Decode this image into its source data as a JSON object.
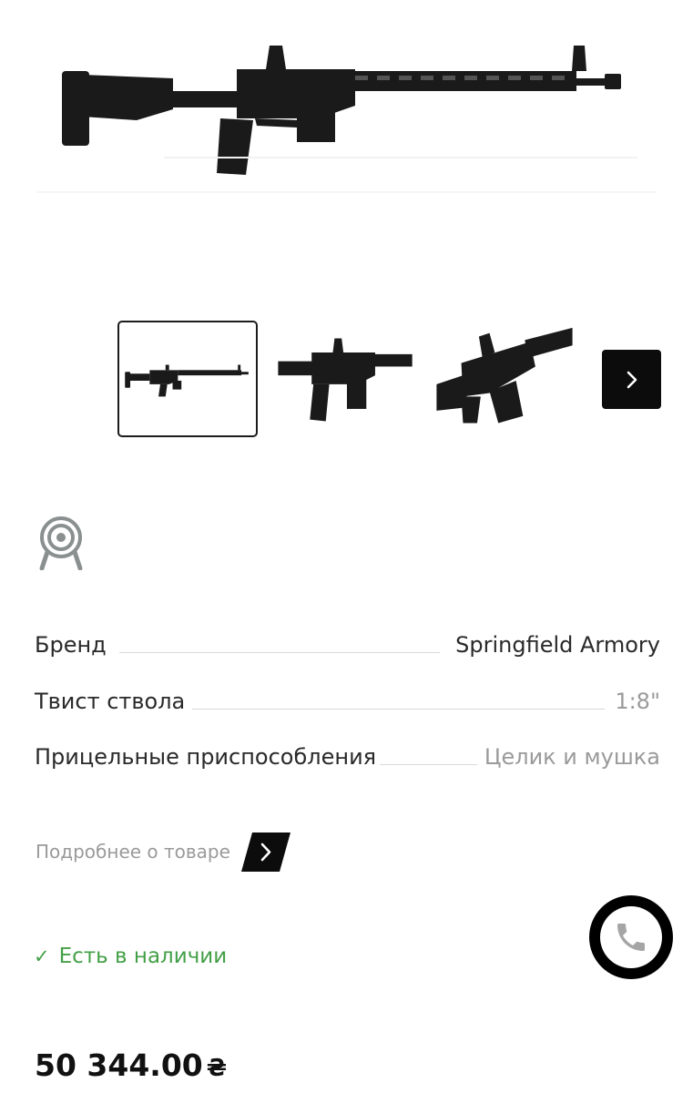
{
  "product": {
    "image_alt": "Springfield Armory rifle"
  },
  "gallery": {
    "thumbnails": [
      {
        "name": "full-rifle"
      },
      {
        "name": "receiver-side"
      },
      {
        "name": "receiver-angle"
      }
    ],
    "active_index": 0
  },
  "specs": [
    {
      "label": "Бренд",
      "value": "Springfield Armory"
    },
    {
      "label": "Твист ствола",
      "value": "1:8\""
    },
    {
      "label": "Прицельные приспособления",
      "value": "Целик и мушка"
    }
  ],
  "more": {
    "label": "Подробнее о товаре"
  },
  "availability": {
    "check": "✓",
    "label": "Есть в наличии",
    "color": "#43a047"
  },
  "price": {
    "amount": "50 344.00",
    "currency": "₴"
  },
  "icons": {
    "next": "chevron-right-icon",
    "target": "target-icon",
    "phone": "phone-icon"
  }
}
